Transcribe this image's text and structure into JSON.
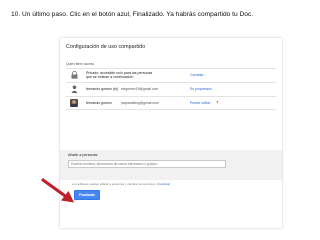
{
  "instruction": "10. Un último  paso. Clic en el botón azul, Finalizado. Ya habrás compartido tu Doc.",
  "dialog": {
    "title": "Configuración de uso compartido",
    "access_heading": "Quién tiene acceso",
    "rows": [
      {
        "icon": "lock-icon",
        "line1": "Privado: accesible solo para las personas",
        "line2": "que se indican a continuación",
        "action": "Cambiar..."
      },
      {
        "icon": "person-icon",
        "name": "fernando gomez (tú)",
        "email": "elegomez19@gmail.com",
        "action": "Es propietario"
      },
      {
        "icon": "avatar-icon",
        "name": "fernando gomez",
        "email": "papowalking@gmail.com",
        "action": "Puede editar"
      }
    ],
    "add_people": {
      "label": "Añadir a personas:",
      "placeholder": "Escribir nombres, direcciones de correo electrónico o grupos..."
    },
    "footer_note": "Los editores pueden añadir a personas y cambiar los permisos.",
    "footer_link": "[Cambiar]",
    "done_button": "Finalizado"
  },
  "colors": {
    "link": "#2a6ad3",
    "primary_button": "#4787ed",
    "arrow": "#c0202a"
  }
}
